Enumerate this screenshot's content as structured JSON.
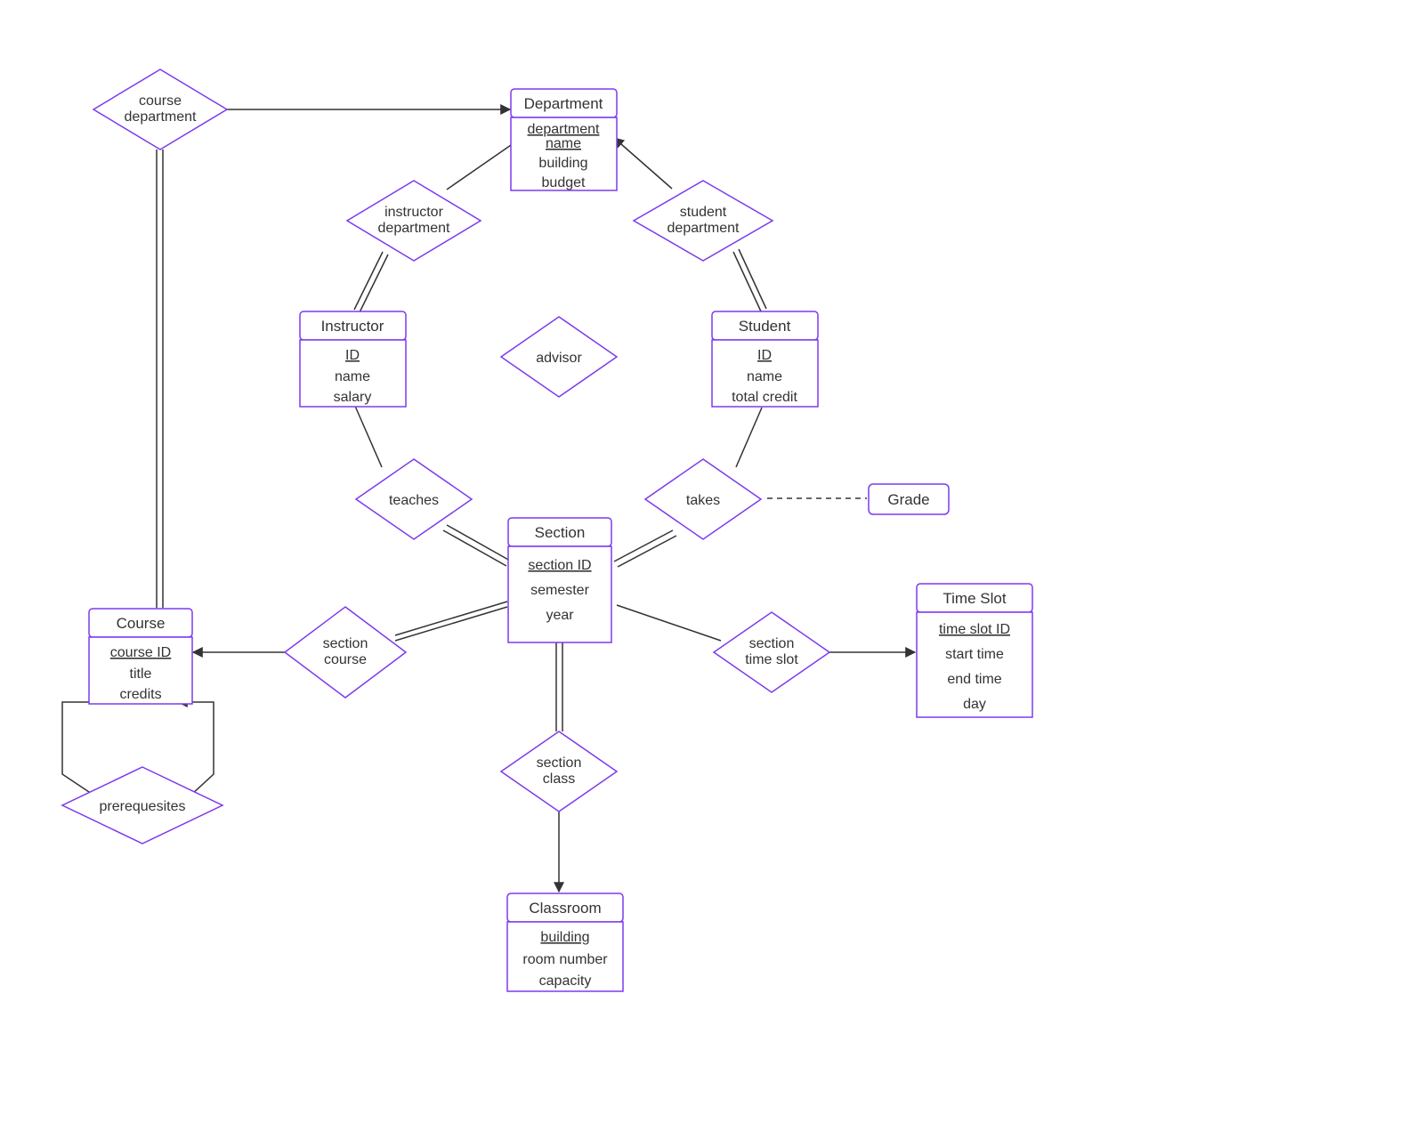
{
  "entities": {
    "department": {
      "title": "Department",
      "attrs": [
        "department name",
        "building",
        "budget"
      ],
      "keys": [
        0
      ]
    },
    "instructor": {
      "title": "Instructor",
      "attrs": [
        "ID",
        "name",
        "salary"
      ],
      "keys": [
        0
      ]
    },
    "student": {
      "title": "Student",
      "attrs": [
        "ID",
        "name",
        "total credit"
      ],
      "keys": [
        0
      ]
    },
    "section": {
      "title": "Section",
      "attrs": [
        "section ID",
        "semester",
        "year"
      ],
      "keys": [
        0
      ]
    },
    "course": {
      "title": "Course",
      "attrs": [
        "course ID",
        "title",
        "credits"
      ],
      "keys": [
        0
      ]
    },
    "classroom": {
      "title": "Classroom",
      "attrs": [
        "building",
        "room number",
        "capacity"
      ],
      "keys": [
        0
      ]
    },
    "timeslot": {
      "title": "Time Slot",
      "attrs": [
        "time slot ID",
        "start time",
        "end time",
        "day"
      ],
      "keys": [
        0
      ]
    },
    "grade": {
      "title": "Grade",
      "attrs": [],
      "keys": []
    }
  },
  "relationships": {
    "course_department": {
      "text": [
        "course",
        "department"
      ]
    },
    "instructor_department": {
      "text": [
        "instructor",
        "department"
      ]
    },
    "student_department": {
      "text": [
        "student",
        "department"
      ]
    },
    "advisor": {
      "text": [
        "advisor"
      ]
    },
    "teaches": {
      "text": [
        "teaches"
      ]
    },
    "takes": {
      "text": [
        "takes"
      ]
    },
    "section_course": {
      "text": [
        "section",
        "course"
      ]
    },
    "section_class": {
      "text": [
        "section",
        "class"
      ]
    },
    "section_time_slot": {
      "text": [
        "section",
        "time slot"
      ]
    },
    "prerequisites": {
      "text": [
        "prerequesites"
      ]
    }
  }
}
